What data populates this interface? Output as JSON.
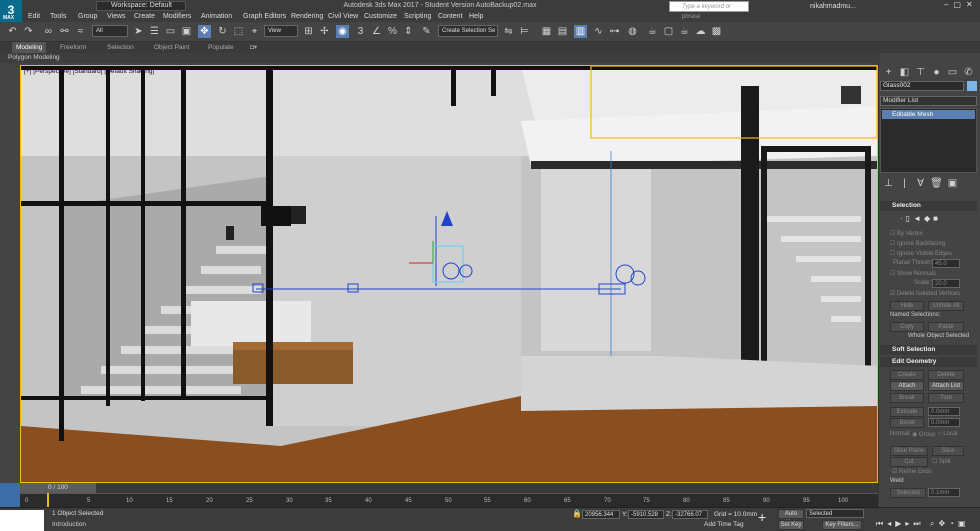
{
  "window": {
    "title": "Autodesk 3ds Max 2017 - Student Version    AutoBackup02.max",
    "logo": "3",
    "logo_sub": "MAX",
    "workspace": "Workspace: Default",
    "search_placeholder": "Type a keyword or phrase",
    "user": "nikahmadmu..."
  },
  "menu": [
    "Edit",
    "Tools",
    "Group",
    "Views",
    "Create",
    "Modifiers",
    "Animation",
    "Graph Editors",
    "Rendering",
    "Civil View",
    "Customize",
    "Scripting",
    "Content",
    "Help"
  ],
  "toolbar": {
    "filter": "All",
    "reference": "View",
    "selection_set": "Create Selection Se"
  },
  "ribbon": {
    "tabs": [
      "Modeling",
      "Freeform",
      "Selection",
      "Object Paint",
      "Populate"
    ],
    "active": "Modeling",
    "sub_label": "Polygon Modeling"
  },
  "viewport": {
    "label": "[+] [Perspective] [Standard] [Default Shading]"
  },
  "command_panel": {
    "object_name": "Glass002",
    "modifier_list": "Modifier List",
    "stack_item": "Editable Mesh",
    "selection": {
      "title": "Selection",
      "options": [
        "By Vertex",
        "Ignore Backfacing",
        "Ignore Visible Edges"
      ],
      "planar_label": "Planar Thresh:",
      "planar_value": "45.0",
      "show_normals": "Show Normals",
      "scale_label": "Scale:",
      "scale_value": "20.0",
      "delete_isolated": "Delete Isolated Vertices",
      "hide": "Hide",
      "unhide_all": "Unhide All",
      "named_selections": "Named Selections:",
      "copy": "Copy",
      "paste": "Paste",
      "status": "Whole Object Selected"
    },
    "soft_selection": {
      "title": "Soft Selection"
    },
    "edit_geometry": {
      "title": "Edit Geometry",
      "create": "Create",
      "delete": "Delete",
      "attach": "Attach",
      "attach_list": "Attach List",
      "break": "Break",
      "turn": "Turn",
      "extrude": "Extrude",
      "extrude_value": "0.0mm",
      "bevel": "Bevel",
      "bevel_value": "0.0mm",
      "normal_label": "Normal:",
      "group": "Group",
      "local": "Local",
      "slice_plane": "Slice Plane",
      "slice": "Slice",
      "cut": "Cut",
      "split": "Split",
      "refine_ends": "Refine Ends",
      "weld": "Weld",
      "selected": "Selected",
      "selected_value": "0.1mm"
    }
  },
  "timeline": {
    "handle": "0 / 100",
    "ticks": [
      "0",
      "5",
      "10",
      "15",
      "20",
      "25",
      "30",
      "35",
      "40",
      "45",
      "50",
      "55",
      "60",
      "65",
      "70",
      "75",
      "80",
      "85",
      "90",
      "95",
      "100"
    ]
  },
  "status": {
    "objects": "1 Object Selected",
    "prompt": "Introduction",
    "x": "20956.344",
    "y": "-5910.528",
    "z": "-32766.07",
    "grid": "Grid = 10.0mm",
    "add_time_tag": "Add Time Tag",
    "auto_key": "Auto Key",
    "set_key": "Set Key",
    "key_mode": "Selected",
    "key_filters": "Key Filters..."
  },
  "colors": {
    "accent": "#5a7fb0",
    "selection_yellow": "#f0c000",
    "floor": "#8a4e1f",
    "helper_blue": "#2244cc"
  }
}
